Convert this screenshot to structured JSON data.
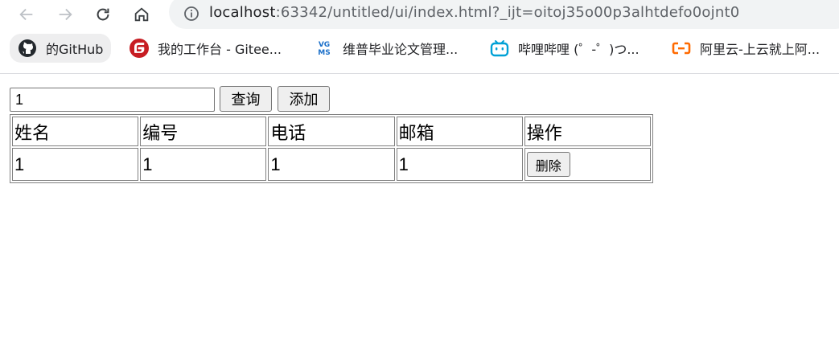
{
  "browser": {
    "url_host": "localhost",
    "url_rest": ":63342/untitled/ui/index.html?_ijt=oitoj35o00p3alhtdefo0ojnt0",
    "bookmarks": [
      {
        "label": "的GitHub",
        "icon": "github-icon"
      },
      {
        "label": "我的工作台 - Gitee...",
        "icon": "gitee-icon"
      },
      {
        "label": "维普毕业论文管理...",
        "icon": "vgms-icon",
        "icon_text": "VG\nMS"
      },
      {
        "label": "哔哩哔哩 (゜-゜)つ...",
        "icon": "bilibili-icon"
      },
      {
        "label": "阿里云-上云就上阿...",
        "icon": "aliyun-icon"
      }
    ]
  },
  "toolbar": {
    "search_value": "1",
    "query_label": "查询",
    "add_label": "添加"
  },
  "table": {
    "headers": [
      "姓名",
      "编号",
      "电话",
      "邮箱",
      "操作"
    ],
    "rows": [
      {
        "name": "1",
        "id": "1",
        "phone": "1",
        "email": "1",
        "action_label": "删除"
      }
    ]
  },
  "colors": {
    "gitee": "#c71d23",
    "bilibili": "#00a1d6",
    "aliyun": "#ff6a00",
    "vgms": "#1a6fc9"
  }
}
